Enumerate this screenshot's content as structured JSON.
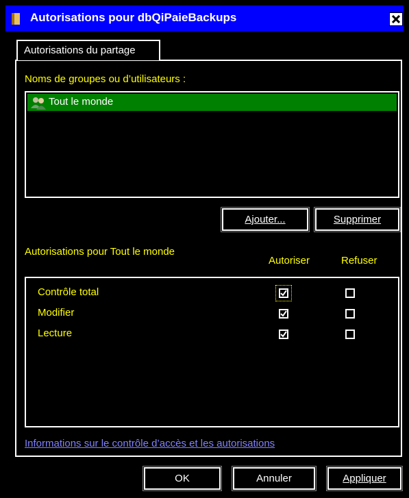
{
  "window": {
    "title": "Autorisations pour dbQiPaieBackups",
    "close_label": "X"
  },
  "tabs": [
    {
      "label": "Autorisations du partage",
      "active": true
    }
  ],
  "users_section": {
    "label": "Noms de groupes ou d’utilisateurs :",
    "items": [
      {
        "label": "Tout le monde",
        "icon": "users-icon",
        "selected": true
      }
    ],
    "add_button": "Ajouter...",
    "remove_button": "Supprimer"
  },
  "permissions": {
    "title": "Autorisations pour Tout le monde",
    "allow_header": "Autoriser",
    "deny_header": "Refuser",
    "rows": [
      {
        "name": "Contrôle total",
        "allow": true,
        "deny": false
      },
      {
        "name": "Modifier",
        "allow": true,
        "deny": false
      },
      {
        "name": "Lecture",
        "allow": true,
        "deny": false
      }
    ]
  },
  "help_link": "Informations sur le contrôle d’accès et les autorisations",
  "footer": {
    "ok": "OK",
    "cancel": "Annuler",
    "apply": "Appliquer"
  },
  "colors": {
    "background": "#000000",
    "titlebar": "#0000ff",
    "selection": "#008000",
    "label_text": "#ffff00",
    "link": "#8080ff"
  }
}
